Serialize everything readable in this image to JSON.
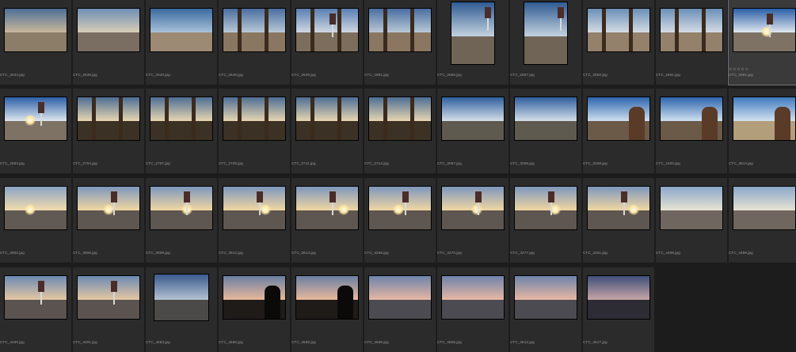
{
  "grid": {
    "thumbnails": [
      {
        "filename": "CTC_2634.jpg",
        "scene": "pillar"
      },
      {
        "filename": "CTC_2636.jpg",
        "scene": "car"
      },
      {
        "filename": "CTC_2640.jpg",
        "scene": "desert"
      },
      {
        "filename": "CTC_2646.jpg",
        "scene": "window"
      },
      {
        "filename": "CTC_2649.jpg",
        "scene": "window-sign"
      },
      {
        "filename": "CTC_2651.jpg",
        "scene": "window"
      },
      {
        "filename": "CTC_2655.jpg",
        "scene": "sign-portrait",
        "portrait": true
      },
      {
        "filename": "CTC_2657.jpg",
        "scene": "sign-portrait",
        "portrait": true
      },
      {
        "filename": "CTC_2660.jpg",
        "scene": "door"
      },
      {
        "filename": "CTC_2661.jpg",
        "scene": "door"
      },
      {
        "filename": "CTC_2681.jpg",
        "scene": "sign-day",
        "selected": true,
        "rating": "☆☆☆☆☆"
      },
      {
        "filename": "CTC_2684.jpg",
        "scene": "sign-day"
      },
      {
        "filename": "CTC_2704.jpg",
        "scene": "window-dark"
      },
      {
        "filename": "CTC_2707.jpg",
        "scene": "window-dark"
      },
      {
        "filename": "CTC_2709.jpg",
        "scene": "window-dark"
      },
      {
        "filename": "CTC_2711.jpg",
        "scene": "window-dark"
      },
      {
        "filename": "CTC_2714.jpg",
        "scene": "window-dark"
      },
      {
        "filename": "CTC_3057.jpg",
        "scene": "building"
      },
      {
        "filename": "CTC_3058.jpg",
        "scene": "building"
      },
      {
        "filename": "CTC_3468.jpg",
        "scene": "man"
      },
      {
        "filename": "CTC_3482.jpg",
        "scene": "man"
      },
      {
        "filename": "CTC_3514.jpg",
        "scene": "man-hat"
      },
      {
        "filename": "CTC_3902.jpg",
        "scene": "sunset"
      },
      {
        "filename": "CTC_3906.jpg",
        "scene": "sunset-sign"
      },
      {
        "filename": "CTC_3909.jpg",
        "scene": "sunset-sign"
      },
      {
        "filename": "CTC_3912.jpg",
        "scene": "sunset-sign"
      },
      {
        "filename": "CTC_3914.jpg",
        "scene": "sunset-sign"
      },
      {
        "filename": "CTC_4269.jpg",
        "scene": "sunset-sign"
      },
      {
        "filename": "CTC_4270.jpg",
        "scene": "sunset-sign"
      },
      {
        "filename": "CTC_4277.jpg",
        "scene": "sunset-sign"
      },
      {
        "filename": "CTC_4281.jpg",
        "scene": "sunset-sign"
      },
      {
        "filename": "CTC_4488.jpg",
        "scene": "station"
      },
      {
        "filename": "CTC_4489.jpg",
        "scene": "station"
      },
      {
        "filename": "CTC_4490.jpg",
        "scene": "dusk-sign"
      },
      {
        "filename": "CTC_4491.jpg",
        "scene": "dusk-sign"
      },
      {
        "filename": "CTC_4583.jpg",
        "scene": "house",
        "mid": true
      },
      {
        "filename": "CTC_4586.jpg",
        "scene": "silhouette"
      },
      {
        "filename": "CTC_4588.jpg",
        "scene": "silhouette"
      },
      {
        "filename": "CTC_4596.jpg",
        "scene": "dusk"
      },
      {
        "filename": "CTC_4608.jpg",
        "scene": "dusk"
      },
      {
        "filename": "CTC_4612.jpg",
        "scene": "dusk"
      },
      {
        "filename": "CTC_4617.jpg",
        "scene": "dusk-dark"
      }
    ]
  }
}
